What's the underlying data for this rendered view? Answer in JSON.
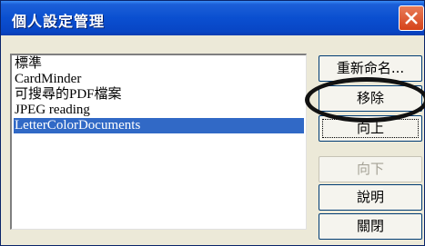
{
  "window": {
    "title": "個人設定管理"
  },
  "titlebar": {
    "close_icon": "close-x-icon"
  },
  "list": {
    "items": [
      {
        "label": "標準",
        "selected": false
      },
      {
        "label": "CardMinder",
        "selected": false
      },
      {
        "label": "可搜尋的PDF檔案",
        "selected": false
      },
      {
        "label": "JPEG reading",
        "selected": false
      },
      {
        "label": "LetterColorDocuments",
        "selected": true
      }
    ]
  },
  "buttons": {
    "rename": "重新命名...",
    "remove": "移除",
    "up": "向上",
    "down": "向下",
    "help": "說明",
    "close": "關閉"
  },
  "colors": {
    "titlebar": "#0a4fd0",
    "selection": "#3169c6",
    "dialog_bg": "#ece9d8"
  }
}
